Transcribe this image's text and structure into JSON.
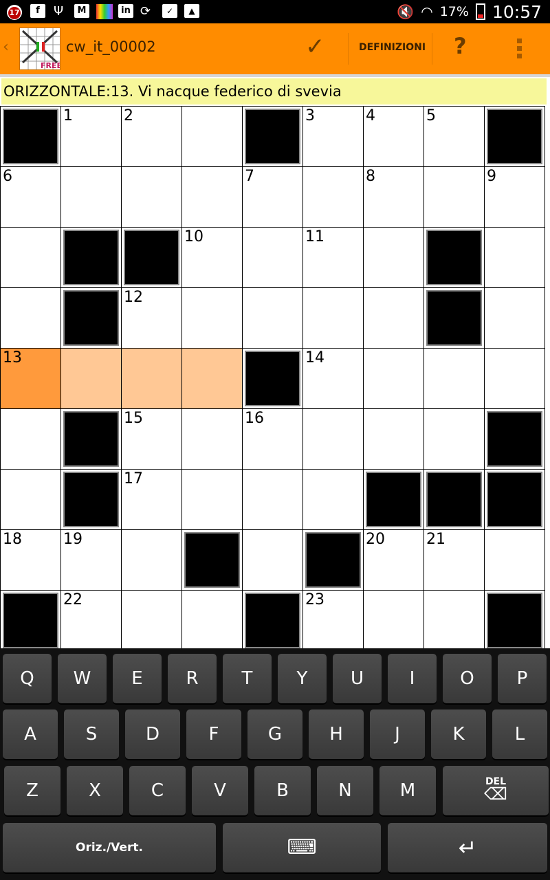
{
  "status_bar": {
    "notification_count": "17",
    "icons": [
      "notification-badge-icon",
      "facebook-icon",
      "usb-icon",
      "gmail-icon",
      "game-icon",
      "linkedin-icon",
      "sync-icon",
      "briefcase-icon",
      "shopping-bag-icon"
    ],
    "battery_pct": "17%",
    "clock": "10:57"
  },
  "action_bar": {
    "back_glyph": "‹",
    "title": "cw_it_00002",
    "logo_badge": "FREE",
    "check_glyph": "✓",
    "definitions_label": "DEFINIZIONI",
    "help_glyph": "?",
    "accent_color": "#ff8c00"
  },
  "clue": {
    "text": "ORIZZONTALE:13. Vi nacque federico di svevia"
  },
  "grid": {
    "cols": 9,
    "rows_visible": 9,
    "layout": [
      "#...#...#",
      ".........",
      ".##....#.",
      ".#.....#.",
      "....#....",
      ".#......#.",
      ".#....###",
      "...#.#...",
      "#...#...#"
    ],
    "numbers": [
      {
        "row": 0,
        "col": 1,
        "n": "1"
      },
      {
        "row": 0,
        "col": 2,
        "n": "2"
      },
      {
        "row": 0,
        "col": 5,
        "n": "3"
      },
      {
        "row": 0,
        "col": 6,
        "n": "4"
      },
      {
        "row": 0,
        "col": 7,
        "n": "5"
      },
      {
        "row": 1,
        "col": 0,
        "n": "6"
      },
      {
        "row": 1,
        "col": 4,
        "n": "7"
      },
      {
        "row": 1,
        "col": 6,
        "n": "8"
      },
      {
        "row": 1,
        "col": 8,
        "n": "9"
      },
      {
        "row": 2,
        "col": 3,
        "n": "10"
      },
      {
        "row": 2,
        "col": 5,
        "n": "11"
      },
      {
        "row": 3,
        "col": 2,
        "n": "12"
      },
      {
        "row": 4,
        "col": 0,
        "n": "13"
      },
      {
        "row": 4,
        "col": 5,
        "n": "14"
      },
      {
        "row": 5,
        "col": 2,
        "n": "15"
      },
      {
        "row": 5,
        "col": 4,
        "n": "16"
      },
      {
        "row": 6,
        "col": 2,
        "n": "17"
      },
      {
        "row": 7,
        "col": 0,
        "n": "18"
      },
      {
        "row": 7,
        "col": 1,
        "n": "19"
      },
      {
        "row": 7,
        "col": 6,
        "n": "20"
      },
      {
        "row": 7,
        "col": 7,
        "n": "21"
      },
      {
        "row": 8,
        "col": 1,
        "n": "22"
      },
      {
        "row": 8,
        "col": 5,
        "n": "23"
      }
    ],
    "current_cell": {
      "row": 4,
      "col": 0
    },
    "highlighted_cells": [
      {
        "row": 4,
        "col": 1
      },
      {
        "row": 4,
        "col": 2
      },
      {
        "row": 4,
        "col": 3
      }
    ],
    "highlight_color": "#ffc895",
    "current_color": "#ff9a3c"
  },
  "keyboard": {
    "row1": [
      "Q",
      "W",
      "E",
      "R",
      "T",
      "Y",
      "U",
      "I",
      "O",
      "P"
    ],
    "row2": [
      "A",
      "S",
      "D",
      "F",
      "G",
      "H",
      "J",
      "K",
      "L"
    ],
    "row3": [
      "Z",
      "X",
      "C",
      "V",
      "B",
      "N",
      "M"
    ],
    "del_label": "DEL",
    "del_glyph": "⌫",
    "toggle_label": "Oriz./Vert.",
    "keyboard_glyph": "⌨",
    "enter_glyph": "↵"
  }
}
